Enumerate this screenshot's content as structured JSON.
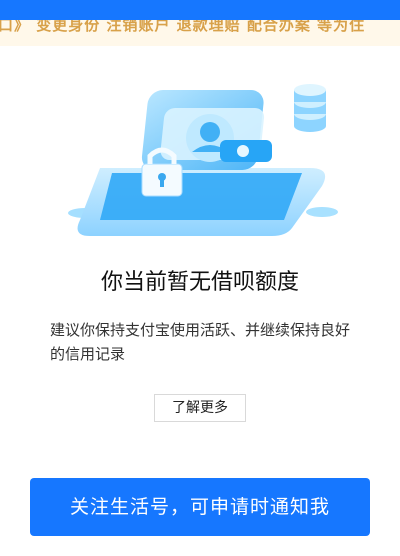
{
  "header": {
    "banner_text": "口》 变更身份  注销账户  退款理赔  配合办案  等为住"
  },
  "empty_state": {
    "illustration": "lock-wallet-icon",
    "title": "你当前暂无借呗额度",
    "description": "建议你保持支付宝使用活跃、并继续保持良好的信用记录",
    "learn_more_label": "了解更多"
  },
  "footer": {
    "cta_label": "关注生活号，可申请时通知我"
  },
  "colors": {
    "accent": "#1677ff",
    "banner_bg": "#fff8ea",
    "banner_text": "#d8a14a"
  }
}
